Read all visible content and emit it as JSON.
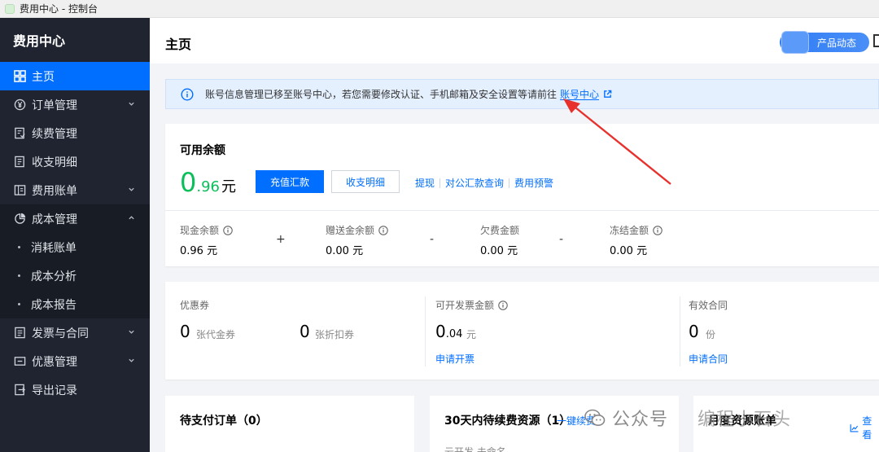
{
  "window": {
    "title": "费用中心 - 控制台"
  },
  "sidebar": {
    "brand": "费用中心",
    "items": [
      {
        "label": "主页",
        "icon": "grid-icon",
        "active": true
      },
      {
        "label": "订单管理",
        "icon": "yen-circle-icon",
        "chevron": "down"
      },
      {
        "label": "续费管理",
        "icon": "renew-icon"
      },
      {
        "label": "收支明细",
        "icon": "ledger-icon"
      },
      {
        "label": "费用账单",
        "icon": "bill-icon",
        "chevron": "down"
      },
      {
        "label": "成本管理",
        "icon": "pie-icon",
        "chevron": "up"
      },
      {
        "label": "消耗账单",
        "sub": true
      },
      {
        "label": "成本分析",
        "sub": true
      },
      {
        "label": "成本报告",
        "sub": true
      },
      {
        "label": "发票与合同",
        "icon": "invoice-icon",
        "chevron": "down"
      },
      {
        "label": "优惠管理",
        "icon": "coupon-icon",
        "chevron": "down"
      },
      {
        "label": "导出记录",
        "icon": "export-icon"
      }
    ]
  },
  "header": {
    "title": "主页",
    "promo_label": "产品动态"
  },
  "notice": {
    "text": "账号信息管理已移至账号中心，若您需要修改认证、手机邮箱及安全设置等请前往",
    "link": "账号中心"
  },
  "balance": {
    "title": "可用余额",
    "amount_int": "0",
    "amount_dec": ".96",
    "unit": "元",
    "recharge_label": "充值汇款",
    "detail_label": "收支明细",
    "links": [
      "提现",
      "对公汇款查询",
      "费用预警"
    ],
    "stats": [
      {
        "label": "现金余额",
        "value": "0.96 元"
      },
      {
        "label": "赠送金余额",
        "value": "0.00 元"
      },
      {
        "label": "欠费金额",
        "value": "0.00 元"
      },
      {
        "label": "冻结金额",
        "value": "0.00 元"
      }
    ],
    "operators": [
      "+",
      "-",
      "-"
    ]
  },
  "coupons": {
    "title": "优惠券",
    "voucher_count": "0",
    "voucher_label": "张代金券",
    "discount_count": "0",
    "discount_label": "张折扣券",
    "invoice_title": "可开发票金额",
    "invoice_int": "0",
    "invoice_dec": ".04",
    "invoice_unit": "元",
    "invoice_link": "申请开票",
    "contract_title": "有效合同",
    "contract_count": "0",
    "contract_unit": "份",
    "contract_link": "申请合同"
  },
  "bottom": {
    "pending_orders": "待支付订单（0）",
    "renewal": "30天内待续费资源（1）",
    "renewal_link": "一键续费",
    "renewal_sub": "云开发 未命名",
    "monthly": "月度资源账单",
    "monthly_link": "查看"
  },
  "watermark": {
    "brand": "公众号",
    "author": "编程小石头"
  },
  "colors": {
    "accent": "#006eff",
    "sidebar": "#1f2430",
    "green": "#0abf5b",
    "arrow": "#e8312c"
  }
}
